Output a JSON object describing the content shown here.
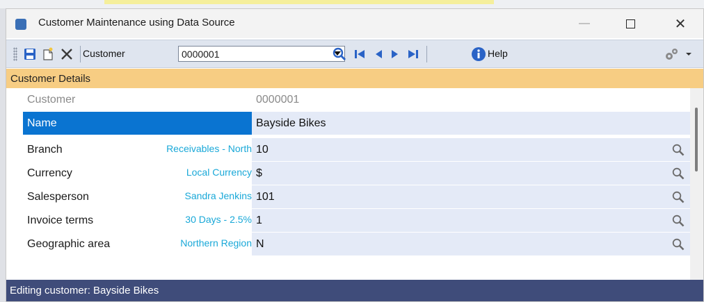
{
  "window": {
    "title": "Customer Maintenance using Data Source"
  },
  "toolbar": {
    "customer_label": "Customer",
    "customer_value": "0000001",
    "help_label": "Help"
  },
  "section": {
    "title": "Customer Details"
  },
  "fields": [
    {
      "label": "Customer",
      "description": "",
      "value": "0000001"
    },
    {
      "label": "Name",
      "description": "",
      "value": "Bayside Bikes"
    },
    {
      "label": "Branch",
      "description": "Receivables - North",
      "value": "10"
    },
    {
      "label": "Currency",
      "description": "Local Currency",
      "value": "$"
    },
    {
      "label": "Salesperson",
      "description": "Sandra Jenkins",
      "value": "101"
    },
    {
      "label": "Invoice terms",
      "description": "30 Days - 2.5%",
      "value": "1"
    },
    {
      "label": "Geographic area",
      "description": "Northern Region",
      "value": "N"
    }
  ],
  "status": {
    "text": "Editing customer: Bayside Bikes"
  },
  "colors": {
    "accent_header": "#f7cd83",
    "selected_row": "#0a74d1",
    "status_bar": "#3f4c7a",
    "description_link": "#19a8d8",
    "toolbar_icons": "#2a63c6"
  },
  "icons": [
    "save-icon",
    "new-icon",
    "delete-icon",
    "search-icon",
    "first-record-icon",
    "previous-record-icon",
    "next-record-icon",
    "last-record-icon",
    "info-icon",
    "settings-icon"
  ]
}
